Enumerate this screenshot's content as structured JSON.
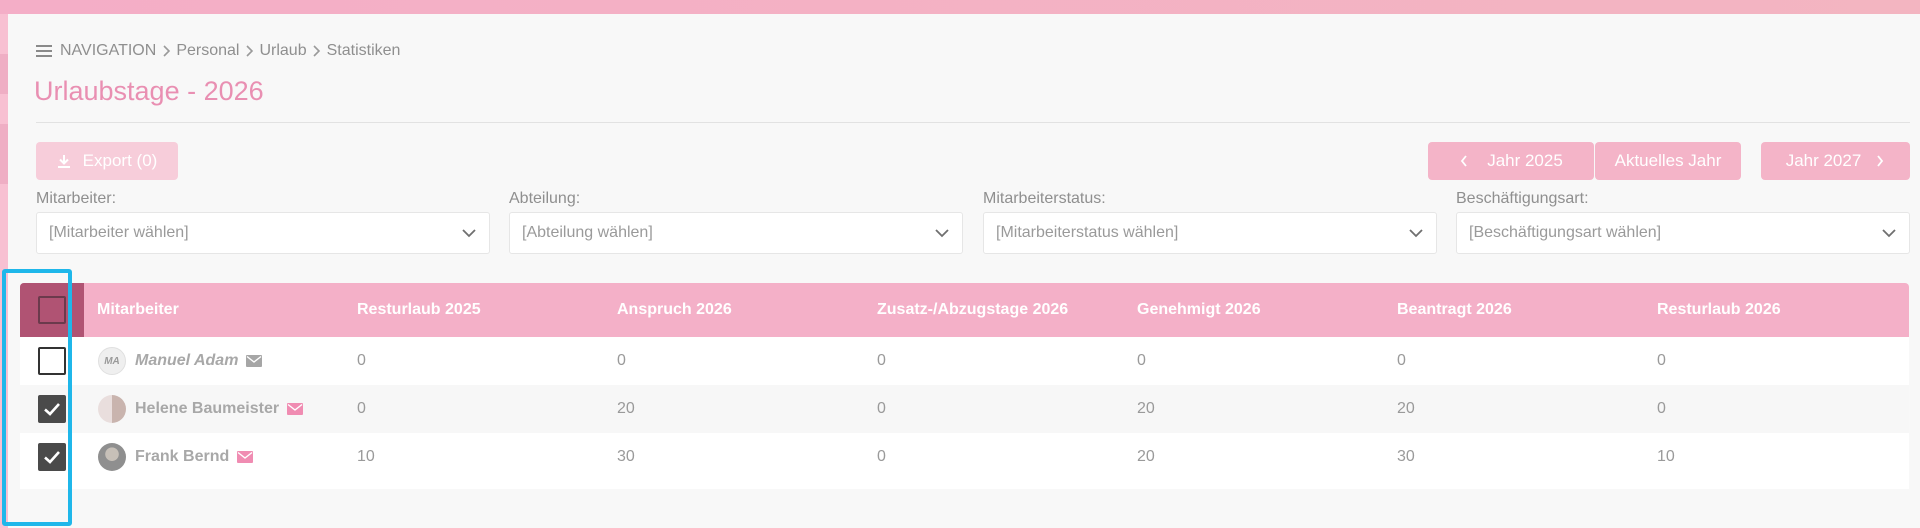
{
  "breadcrumb": {
    "items": [
      "NAVIGATION",
      "Personal",
      "Urlaub",
      "Statistiken"
    ]
  },
  "page": {
    "title": "Urlaubstage - 2026"
  },
  "toolbar": {
    "export_label": "Export (0)",
    "prev_year_label": "Jahr 2025",
    "current_year_label": "Aktuelles Jahr",
    "next_year_label": "Jahr 2027"
  },
  "filters": [
    {
      "label": "Mitarbeiter:",
      "placeholder": "[Mitarbeiter wählen]"
    },
    {
      "label": "Abteilung:",
      "placeholder": "[Abteilung wählen]"
    },
    {
      "label": "Mitarbeiterstatus:",
      "placeholder": "[Mitarbeiterstatus wählen]"
    },
    {
      "label": "Beschäftigungsart:",
      "placeholder": "[Beschäftigungsart wählen]"
    }
  ],
  "table": {
    "columns": [
      "Mitarbeiter",
      "Resturlaub 2025",
      "Anspruch 2026",
      "Zusatz-/Abzugstage 2026",
      "Genehmigt 2026",
      "Beantragt 2026",
      "Resturlaub 2026"
    ],
    "rows": [
      {
        "initials": "MA",
        "name": "Manuel Adam",
        "checked": false,
        "values": [
          "0",
          "0",
          "0",
          "0",
          "0",
          "0"
        ]
      },
      {
        "initials": "",
        "name": "Helene Baumeister",
        "checked": true,
        "values": [
          "0",
          "20",
          "0",
          "20",
          "20",
          "0"
        ]
      },
      {
        "initials": "",
        "name": "Frank Bernd",
        "checked": true,
        "values": [
          "10",
          "30",
          "0",
          "20",
          "30",
          "10"
        ]
      }
    ]
  },
  "colors": {
    "accent": "#f4b0c8",
    "title": "#e98fb2",
    "header_checkbox_bg": "#b05373",
    "highlight": "#1fb7ea"
  }
}
